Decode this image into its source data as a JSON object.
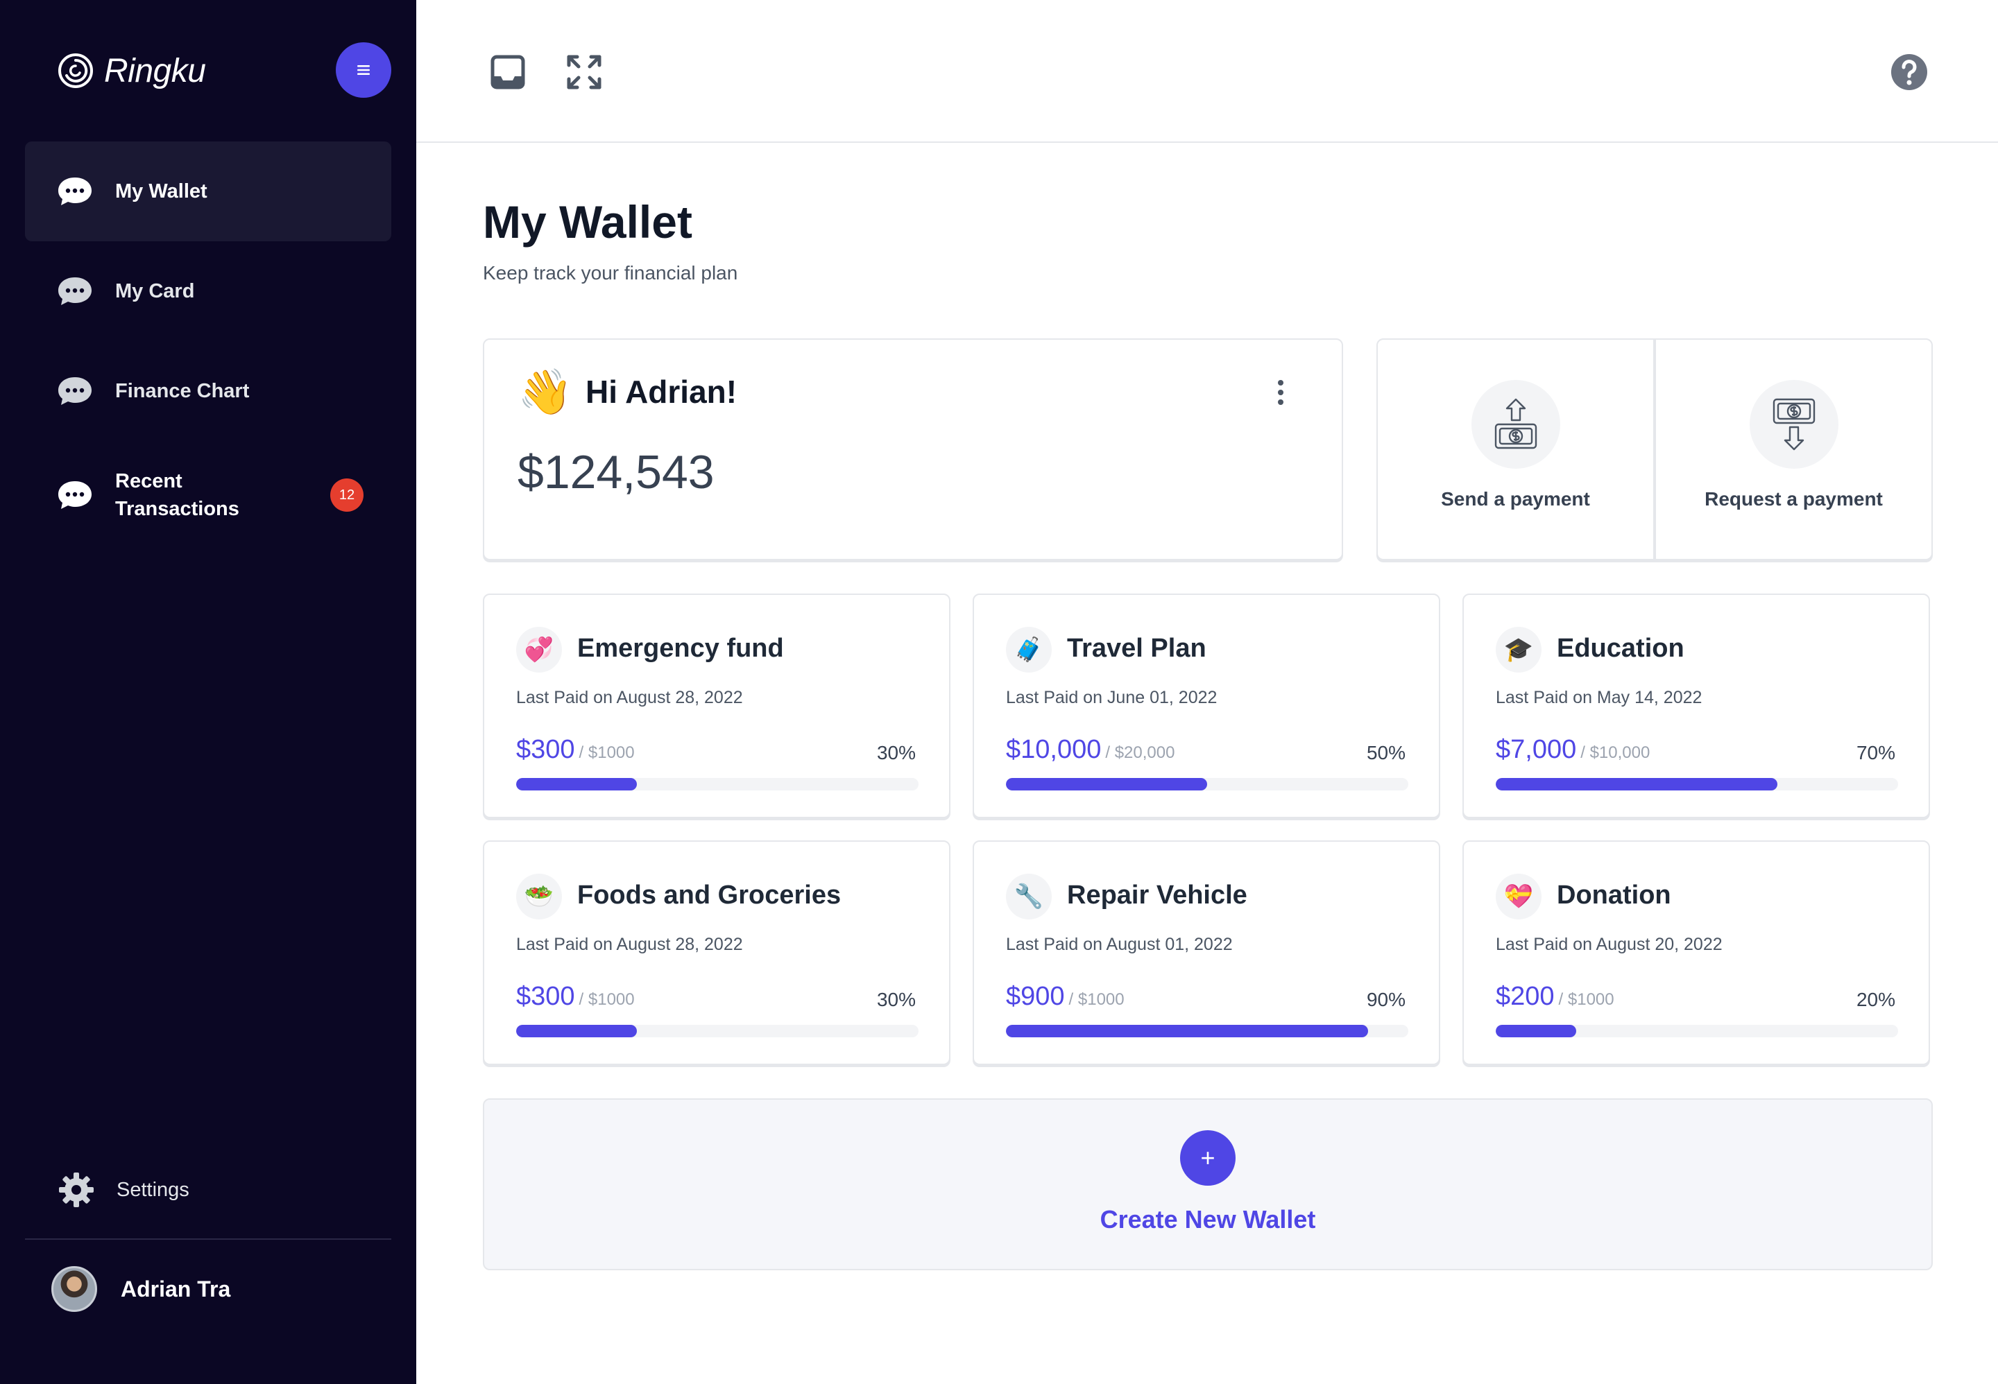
{
  "app": {
    "name": "Ringku"
  },
  "sidebar": {
    "items": [
      {
        "label": "My Wallet",
        "icon": "chat-bubble-icon",
        "active": true
      },
      {
        "label": "My Card",
        "icon": "chat-bubble-icon"
      },
      {
        "label": "Finance Chart",
        "icon": "chat-bubble-icon"
      },
      {
        "label": "Recent Transactions",
        "label_line1": "Recent",
        "label_line2": "Transactions",
        "icon": "chat-bubble-icon",
        "badge": "12"
      }
    ],
    "settings_label": "Settings",
    "user_name": "Adrian Tra"
  },
  "header": {
    "title": "My Wallet",
    "subtitle": "Keep track your financial plan"
  },
  "greeting": {
    "emoji": "👋",
    "title": "Hi Adrian!",
    "balance": "$124,543"
  },
  "payments": {
    "send_label": "Send a payment",
    "request_label": "Request a payment"
  },
  "wallets": [
    {
      "name": "Emergency fund",
      "emoji": "💞",
      "last_paid": "Last Paid on August 28, 2022",
      "amount": "$300",
      "total": "/ $1000",
      "percent_label": "30%",
      "progress": 0.3
    },
    {
      "name": "Travel Plan",
      "emoji": "🧳",
      "last_paid": "Last Paid on June 01, 2022",
      "amount": "$10,000",
      "total": "/ $20,000",
      "percent_label": "50%",
      "progress": 0.5
    },
    {
      "name": "Education",
      "emoji": "🎓",
      "last_paid": "Last Paid on May 14, 2022",
      "amount": "$7,000",
      "total": "/ $10,000",
      "percent_label": "70%",
      "progress": 0.7
    },
    {
      "name": "Foods and Groceries",
      "emoji": "🥗",
      "last_paid": "Last Paid on August 28, 2022",
      "amount": "$300",
      "total": "/ $1000",
      "percent_label": "30%",
      "progress": 0.3
    },
    {
      "name": "Repair Vehicle",
      "emoji": "🔧",
      "last_paid": "Last Paid on August 01, 2022",
      "amount": "$900",
      "total": "/ $1000",
      "percent_label": "90%",
      "progress": 0.9
    },
    {
      "name": "Donation",
      "emoji": "💝",
      "last_paid": "Last Paid on August 20, 2022",
      "amount": "$200",
      "total": "/ $1000",
      "percent_label": "20%",
      "progress": 0.2
    }
  ],
  "create": {
    "plus": "+",
    "label": "Create New Wallet"
  },
  "colors": {
    "sidebar_bg": "#0b0724",
    "accent": "#4f46e5",
    "badge": "#e53e2e"
  }
}
